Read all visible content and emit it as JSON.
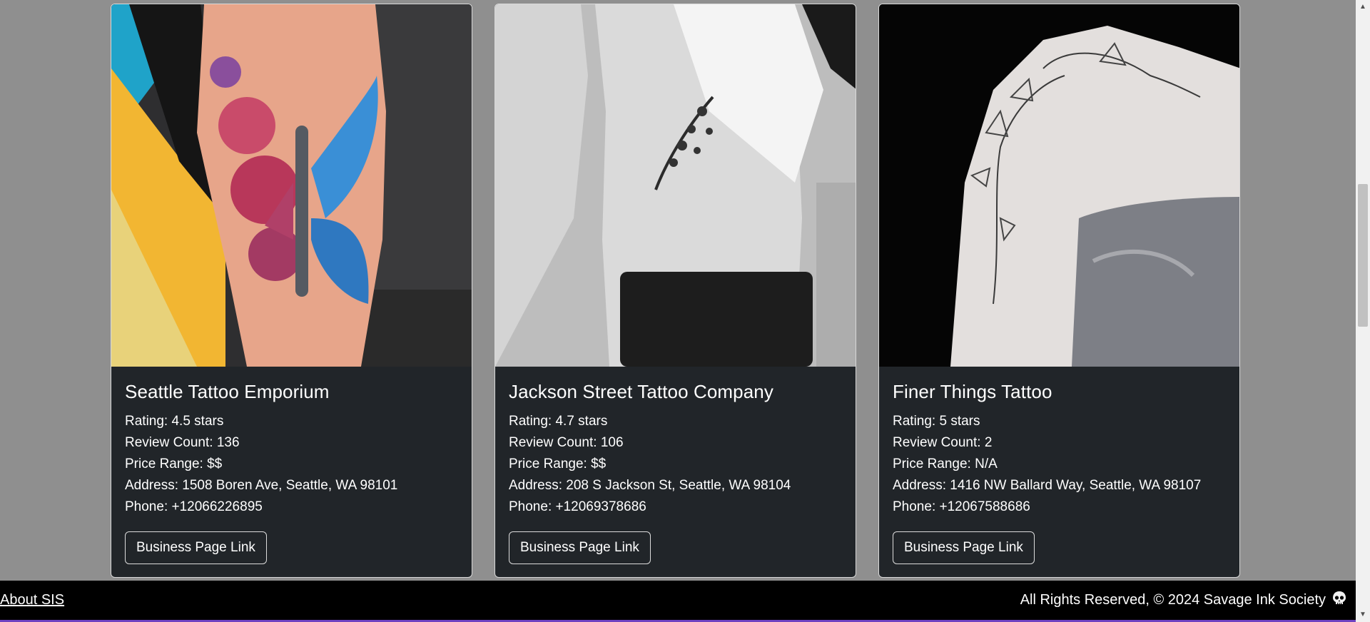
{
  "cards": [
    {
      "title": "Seattle Tattoo Emporium",
      "rating": "Rating: 4.5 stars",
      "review_count": "Review Count: 136",
      "price_range": "Price Range: $$",
      "address": "Address: 1508 Boren Ave, Seattle, WA 98101",
      "phone": "Phone: +12066226895",
      "button_label": "Business Page Link"
    },
    {
      "title": "Jackson Street Tattoo Company",
      "rating": "Rating: 4.7 stars",
      "review_count": "Review Count: 106",
      "price_range": "Price Range: $$",
      "address": "Address: 208 S Jackson St, Seattle, WA 98104",
      "phone": "Phone: +12069378686",
      "button_label": "Business Page Link"
    },
    {
      "title": "Finer Things Tattoo",
      "rating": "Rating: 5 stars",
      "review_count": "Review Count: 2",
      "price_range": "Price Range: N/A",
      "address": "Address: 1416 NW Ballard Way, Seattle, WA 98107",
      "phone": "Phone: +12067588686",
      "button_label": "Business Page Link"
    }
  ],
  "footer": {
    "about_link": "About SIS",
    "copyright": "All Rights Reserved, © 2024 Savage Ink Society",
    "icon": "skull-icon"
  },
  "colors": {
    "page_bg": "#8f8f8f",
    "card_bg": "#212529",
    "footer_bg": "#000000",
    "footer_accent": "#6f42c1"
  }
}
